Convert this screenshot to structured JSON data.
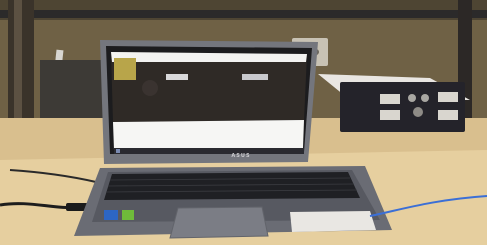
{
  "scene": {
    "description_free": true,
    "laptop_brand": "ASUS",
    "colors": {
      "wall": "#7a6a4a",
      "shelf": "#d3b98a",
      "desk": "#e7cf9e",
      "laptop_body": "#6d6f78",
      "screen_frame": "#1c1c1e",
      "screen_white": "#f3f3f1",
      "taskbar": "#2a2a30",
      "cable_blue": "#3b6fd6"
    }
  }
}
